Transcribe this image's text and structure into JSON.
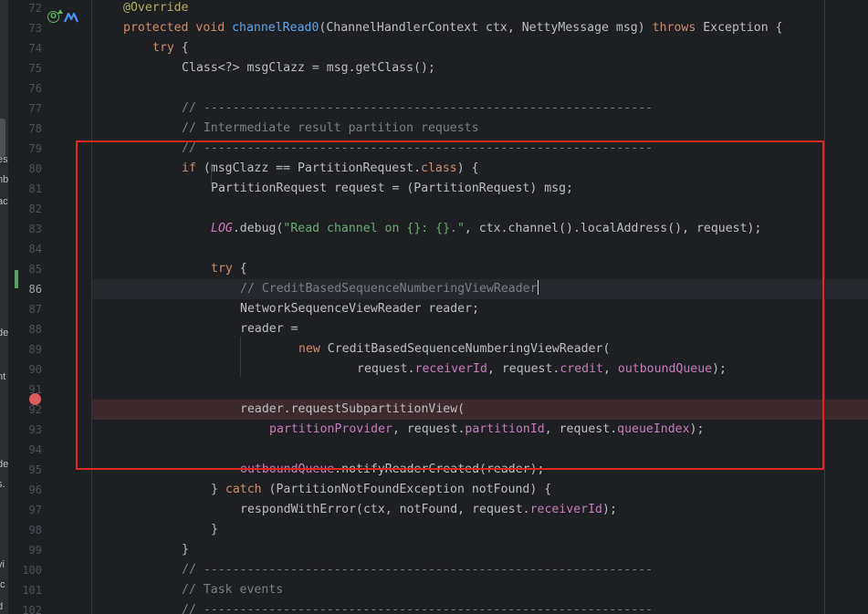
{
  "left_panel_fragments": [
    "es",
    "nb",
    "ac",
    "de",
    "nt",
    "de",
    "s.",
    "vi",
    "tc",
    "d"
  ],
  "gutter": {
    "override_icon": "override-method-icon",
    "implementations_icon": "implementations-icon",
    "breakpoint_icon": "breakpoint-icon",
    "vcs_change_marker": "vcs-modified-line-marker",
    "breakpoint_color": "#db5c5c",
    "vcs_color": "#5a9e62"
  },
  "highlight": {
    "color": "#e0271f"
  },
  "colors": {
    "background": "#1e1f22",
    "keyword": "#cf8e6d",
    "method": "#56a8f5",
    "comment": "#7a7e85",
    "string": "#6aab73",
    "field": "#c77dbb",
    "text": "#bcbec4"
  },
  "lines": [
    {
      "num": "72",
      "tokens": [
        {
          "t": "@Override",
          "c": "ann"
        }
      ]
    },
    {
      "num": "73",
      "tokens": [
        {
          "t": "protected ",
          "c": "kw"
        },
        {
          "t": "void ",
          "c": "kw"
        },
        {
          "t": "channelRead0",
          "c": "fn"
        },
        {
          "t": "(ChannelHandlerContext ctx, NettyMessage msg) "
        },
        {
          "t": "throws ",
          "c": "kw"
        },
        {
          "t": "Exception {"
        }
      ]
    },
    {
      "num": "74",
      "tokens": [
        {
          "t": "try ",
          "c": "kw"
        },
        {
          "t": "{"
        }
      ]
    },
    {
      "num": "75",
      "tokens": [
        {
          "t": "Class<?> msgClazz = msg.getClass();"
        }
      ]
    },
    {
      "num": "76",
      "tokens": []
    },
    {
      "num": "77",
      "tokens": [
        {
          "t": "// --------------------------------------------------------------",
          "c": "cm"
        }
      ]
    },
    {
      "num": "78",
      "tokens": [
        {
          "t": "// Intermediate result partition requests",
          "c": "cm"
        }
      ]
    },
    {
      "num": "79",
      "tokens": [
        {
          "t": "// --------------------------------------------------------------",
          "c": "cm"
        }
      ]
    },
    {
      "num": "80",
      "tokens": [
        {
          "t": "if ",
          "c": "kw"
        },
        {
          "t": "(msgClazz == PartitionRequest."
        },
        {
          "t": "class",
          "c": "kw"
        },
        {
          "t": ") {"
        }
      ]
    },
    {
      "num": "81",
      "tokens": [
        {
          "t": "PartitionRequest request = (PartitionRequest) msg;"
        }
      ]
    },
    {
      "num": "82",
      "tokens": []
    },
    {
      "num": "83",
      "tokens": [
        {
          "t": "LOG",
          "c": "log"
        },
        {
          "t": ".debug("
        },
        {
          "t": "\"Read channel on {}: {}.\"",
          "c": "st"
        },
        {
          "t": ", ctx.channel().localAddress(), request);"
        }
      ]
    },
    {
      "num": "84",
      "tokens": []
    },
    {
      "num": "85",
      "tokens": [
        {
          "t": "try ",
          "c": "kw"
        },
        {
          "t": "{"
        }
      ]
    },
    {
      "num": "86",
      "tokens": [
        {
          "t": "// CreditBasedSequenceNumberingViewReader",
          "c": "cm"
        }
      ]
    },
    {
      "num": "87",
      "tokens": [
        {
          "t": "NetworkSequenceViewReader reader;"
        }
      ]
    },
    {
      "num": "88",
      "tokens": [
        {
          "t": "reader ="
        }
      ]
    },
    {
      "num": "89",
      "tokens": [
        {
          "t": "new ",
          "c": "kw"
        },
        {
          "t": "CreditBasedSequenceNumberingViewReader("
        }
      ]
    },
    {
      "num": "90",
      "tokens": [
        {
          "t": "request."
        },
        {
          "t": "receiverId",
          "c": "fd"
        },
        {
          "t": ", request."
        },
        {
          "t": "credit",
          "c": "fd"
        },
        {
          "t": ", "
        },
        {
          "t": "outboundQueue",
          "c": "fd"
        },
        {
          "t": ");"
        }
      ]
    },
    {
      "num": "91",
      "tokens": []
    },
    {
      "num": "92",
      "tokens": [
        {
          "t": "reader.requestSubpartitionView("
        }
      ]
    },
    {
      "num": "93",
      "tokens": [
        {
          "t": "partitionProvider",
          "c": "fd"
        },
        {
          "t": ", request."
        },
        {
          "t": "partitionId",
          "c": "fd"
        },
        {
          "t": ", request."
        },
        {
          "t": "queueIndex",
          "c": "fd"
        },
        {
          "t": ");"
        }
      ]
    },
    {
      "num": "94",
      "tokens": []
    },
    {
      "num": "95",
      "tokens": [
        {
          "t": "outboundQueue",
          "c": "fd"
        },
        {
          "t": ".notifyReaderCreated(reader);"
        }
      ]
    },
    {
      "num": "96",
      "tokens": [
        {
          "t": "} "
        },
        {
          "t": "catch ",
          "c": "kw"
        },
        {
          "t": "(PartitionNotFoundException notFound) {"
        }
      ]
    },
    {
      "num": "97",
      "tokens": [
        {
          "t": "respondWithError(ctx, notFound, request."
        },
        {
          "t": "receiverId",
          "c": "fd"
        },
        {
          "t": ");"
        }
      ]
    },
    {
      "num": "98",
      "tokens": [
        {
          "t": "}"
        }
      ]
    },
    {
      "num": "99",
      "tokens": [
        {
          "t": "}"
        }
      ]
    },
    {
      "num": "100",
      "tokens": [
        {
          "t": "// --------------------------------------------------------------",
          "c": "cm"
        }
      ]
    },
    {
      "num": "101",
      "tokens": [
        {
          "t": "// Task events",
          "c": "cm"
        }
      ]
    },
    {
      "num": "102",
      "tokens": [
        {
          "t": "// --------------------------------------------------------------",
          "c": "cm"
        }
      ]
    }
  ]
}
